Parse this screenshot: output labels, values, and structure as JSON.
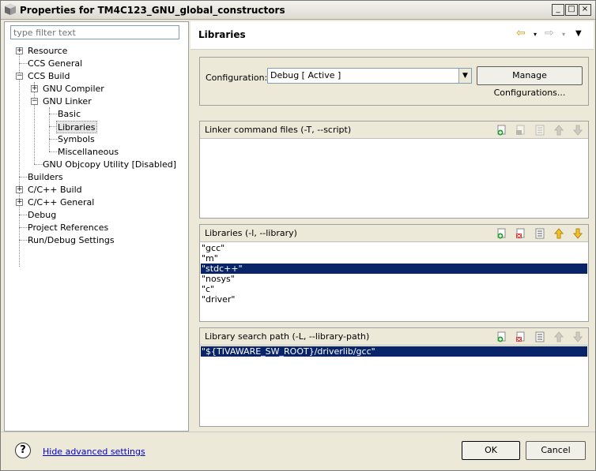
{
  "window": {
    "title": "Properties for TM4C123_GNU_global_constructors",
    "controls": {
      "minimize": "_",
      "maximize": "□",
      "close": "×"
    }
  },
  "filter": {
    "placeholder": "type filter text"
  },
  "tree": {
    "resource": "Resource",
    "ccs_general": "CCS General",
    "ccs_build": "CCS Build",
    "gnu_compiler": "GNU Compiler",
    "gnu_linker": "GNU Linker",
    "basic": "Basic",
    "libraries": "Libraries",
    "symbols": "Symbols",
    "misc": "Miscellaneous",
    "objcopy": "GNU Objcopy Utility  [Disabled]",
    "builders": "Builders",
    "cpp_build": "C/C++ Build",
    "cpp_general": "C/C++ General",
    "debug": "Debug",
    "project_refs": "Project References",
    "run_debug": "Run/Debug Settings"
  },
  "page": {
    "title": "Libraries",
    "configuration_label": "Configuration:",
    "configuration_value": "Debug  [ Active ]",
    "manage_button": "Manage Configurations..."
  },
  "sections": {
    "linker_cmd": {
      "title": "Linker command files (-T, --script)",
      "items": []
    },
    "libraries": {
      "title": "Libraries (-l, --library)",
      "items": [
        "\"gcc\"",
        "\"m\"",
        "\"stdc++\"",
        "\"nosys\"",
        "\"c\"",
        "\"driver\""
      ],
      "selected_index": 2
    },
    "search_path": {
      "title": "Library search path (-L, --library-path)",
      "items": [
        "\"${TIVAWARE_SW_ROOT}/driverlib/gcc\""
      ],
      "selected_index": 0
    }
  },
  "footer": {
    "help_glyph": "?",
    "advanced_link": "Hide advanced settings",
    "ok": "OK",
    "cancel": "Cancel"
  },
  "colors": {
    "selection": "#0a246a",
    "link": "#0000cc"
  }
}
